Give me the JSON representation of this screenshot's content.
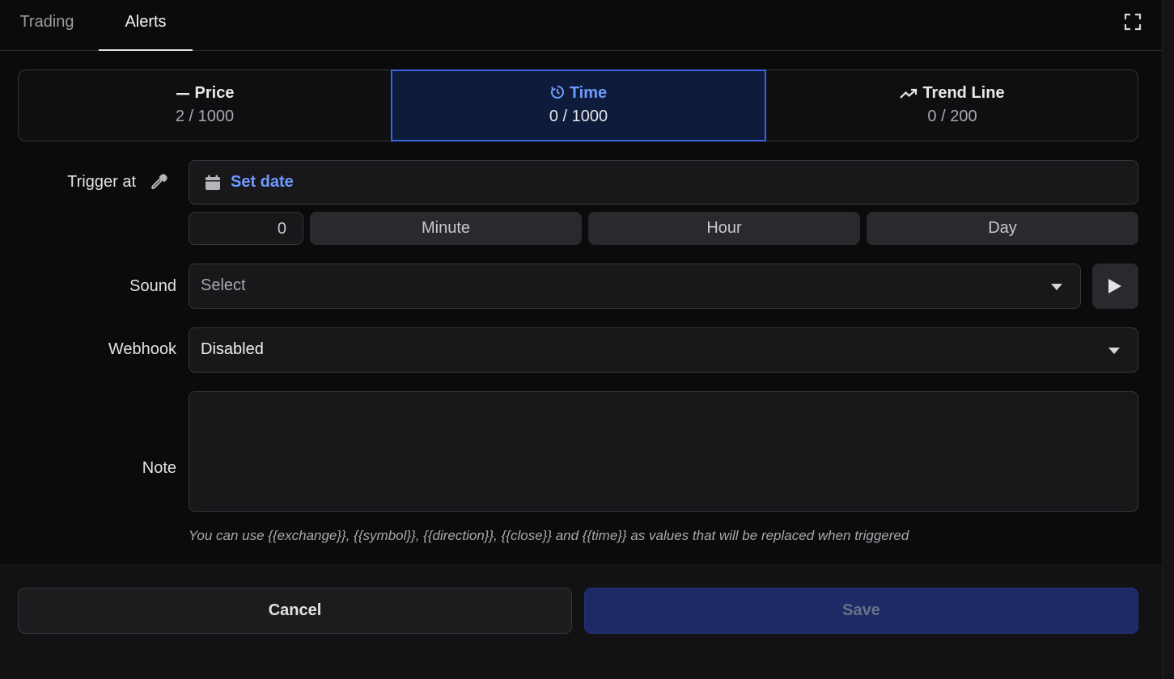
{
  "tabs": [
    {
      "label": "Trading"
    },
    {
      "label": "Alerts"
    }
  ],
  "alert_types": {
    "price": {
      "label": "Price",
      "count": "2 / 1000"
    },
    "time": {
      "label": "Time",
      "count": "0 / 1000"
    },
    "trend": {
      "label": "Trend Line",
      "count": "0 / 200"
    }
  },
  "form": {
    "trigger_label": "Trigger at",
    "set_date": "Set date",
    "offset_value": "0",
    "units": [
      "Minute",
      "Hour",
      "Day"
    ],
    "sound_label": "Sound",
    "sound_value": "Select",
    "webhook_label": "Webhook",
    "webhook_value": "Disabled",
    "note_label": "Note",
    "note_value": "",
    "hint": "You can use {{exchange}}, {{symbol}}, {{direction}}, {{close}} and {{time}} as values that will be replaced when triggered"
  },
  "footer": {
    "cancel": "Cancel",
    "save": "Save"
  },
  "colors": {
    "accent": "#6e9bff",
    "selected_border": "#3b63e0",
    "save_bg": "#1c2b66"
  }
}
